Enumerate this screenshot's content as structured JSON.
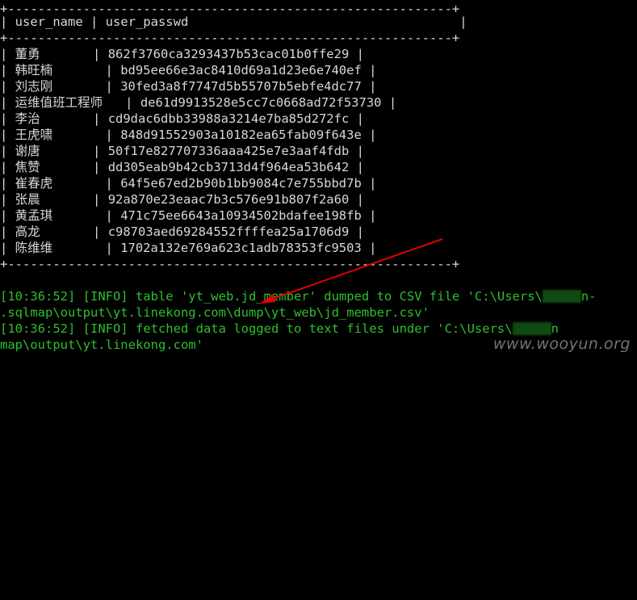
{
  "table": {
    "border_top": "+-----------------------------------------------------------+",
    "header": "| user_name | user_passwd                                    |",
    "border_mid": "+-----------------------------------------------------------+",
    "rows": [
      {
        "name": "董勇",
        "hash": "862f3760ca3293437b53cac01b0ffe29"
      },
      {
        "name": "韩旺楠",
        "hash": "bd95ee66e3ac8410d69a1d23e6e740ef"
      },
      {
        "name": "刘志刚",
        "hash": "30fed3a8f7747d5b55707b5ebfe4dc77"
      },
      {
        "name": "运维值班工程师",
        "hash": "de61d9913528e5cc7c0668ad72f53730"
      },
      {
        "name": "李治",
        "hash": "cd9dac6dbb33988a3214e7ba85d272fc"
      },
      {
        "name": "王虎啸",
        "hash": "848d91552903a10182ea65fab09f643e"
      },
      {
        "name": "谢唐",
        "hash": "50f17e827707336aaa425e7e3aaf4fdb"
      },
      {
        "name": "焦赞",
        "hash": "dd305eab9b42cb3713d4f964ea53b642"
      },
      {
        "name": "崔春虎",
        "hash": "64f5e67ed2b90b1bb9084c7e755bbd7b"
      },
      {
        "name": "张晨",
        "hash": "92a870e23eaac7b3c576e91b807f2a60"
      },
      {
        "name": "黄孟琪",
        "hash": "471c75ee6643a10934502bdafee198fb"
      },
      {
        "name": "高龙",
        "hash": "c98703aed69284552ffffea25a1706d9"
      },
      {
        "name": "陈维维",
        "hash": "1702a132e769a623c1adb78353fc9503"
      }
    ],
    "border_bottom": "+-----------------------------------------------------------+"
  },
  "log": {
    "line1": "[10:36:52] [INFO] table 'yt_web.jd_member' dumped to CSV file 'C:\\Users\\",
    "line1_tail": "n-",
    "line2": ".sqlmap\\output\\yt.linekong.com\\dump\\yt_web\\jd_member.csv'",
    "line3": "[10:36:52] [INFO] fetched data logged to text files under 'C:\\Users\\",
    "line3_tail": "n",
    "line4": "map\\output\\yt.linekong.com'"
  },
  "watermark": "www.wooyun.org",
  "colors": {
    "background": "#000000",
    "text": "#d8d8d8",
    "log_green": "#2fbf2f",
    "arrow_red": "#e00000"
  }
}
